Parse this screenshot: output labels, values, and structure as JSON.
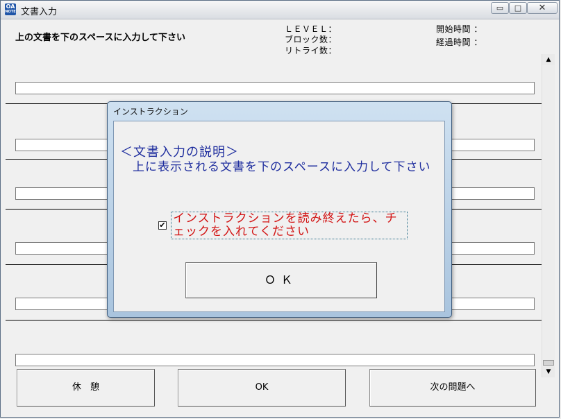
{
  "window": {
    "title": "文書入力",
    "icon_top": "OA",
    "icon_bottom": "NOTE",
    "controls": {
      "minimize": "▭",
      "maximize": "□",
      "close": "✕"
    }
  },
  "header": {
    "instruction": "上の文書を下のスペースに入力して下さい",
    "level_label": "ＬＥＶＥＬ：",
    "block_count_label": "ブロック数：",
    "retry_count_label": "リトライ数：",
    "start_time_label": "開始時間 ：",
    "elapsed_time_label": "経過時間 ："
  },
  "input_rows": [
    {
      "value": ""
    },
    {
      "value": ""
    },
    {
      "value": ""
    },
    {
      "value": ""
    },
    {
      "value": ""
    },
    {
      "value": ""
    }
  ],
  "scrollbar": {
    "up_arrow": "▲",
    "down_arrow": "▼"
  },
  "bottom_buttons": {
    "break_label": "休　憩",
    "ok_label": "OK",
    "next_label": "次の問題へ"
  },
  "dialog": {
    "title": "インストラクション",
    "heading": "＜文書入力の説明＞",
    "body": "上に表示される文書を下のスペースに入力して下さい",
    "checkbox_checked": true,
    "checkbox_mark": "✔",
    "checkbox_label": "インストラクションを読み終えたら、チェックを入れてください",
    "ok_label": "ＯＫ"
  },
  "colors": {
    "dialog_text": "#1e2d9e",
    "warning_text": "#d21414",
    "dialog_frame": "#a9c4de"
  }
}
